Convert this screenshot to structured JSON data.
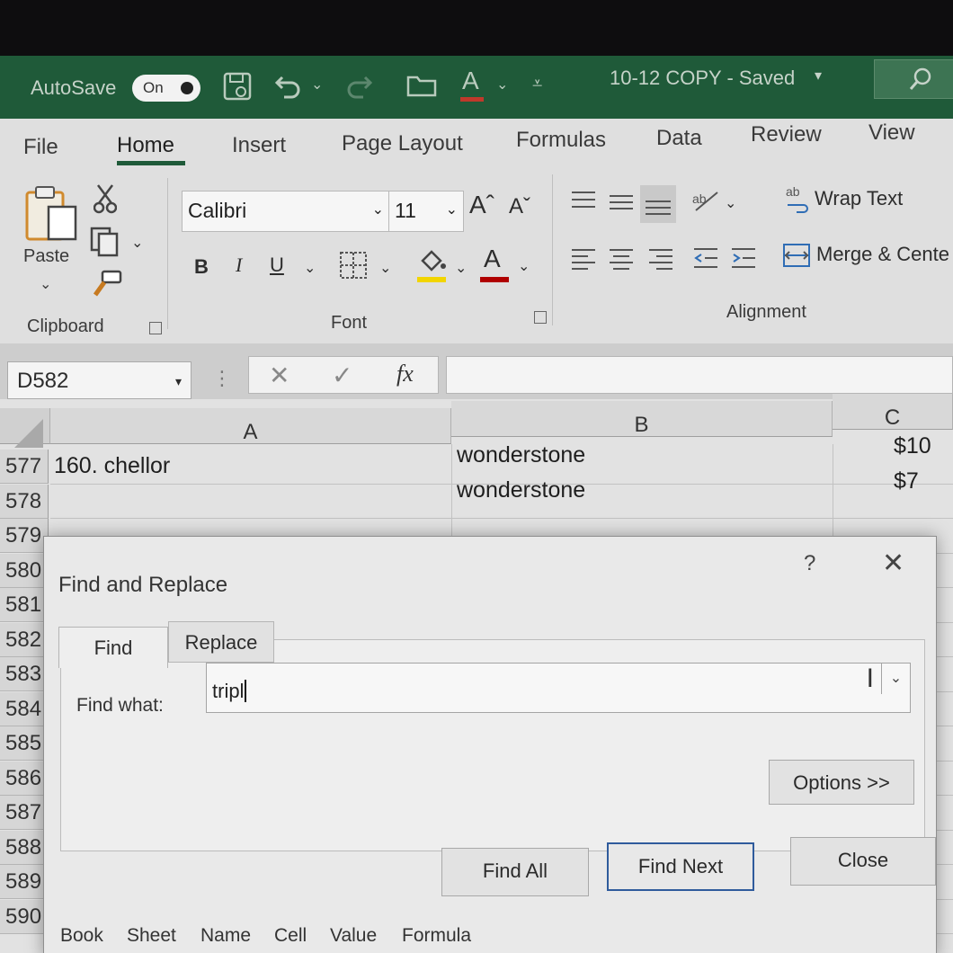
{
  "titlebar": {
    "autosave_label": "AutoSave",
    "autosave_state": "On",
    "doc_title": "10-12 COPY - Saved",
    "doc_title_arrow": "▾",
    "icons": [
      "save-icon",
      "undo-icon",
      "redo-icon",
      "open-folder-icon",
      "font-color-icon",
      "customize-icon",
      "search-icon"
    ]
  },
  "ribbon": {
    "tabs": [
      "File",
      "Home",
      "Insert",
      "Page Layout",
      "Formulas",
      "Data",
      "Review",
      "View"
    ],
    "active_tab": "Home",
    "clipboard": {
      "paste_label": "Paste",
      "group_label": "Clipboard"
    },
    "font": {
      "family": "Calibri",
      "size": "11",
      "bold": "B",
      "italic": "I",
      "underline": "U",
      "group_label": "Font",
      "fill_color": "#f2d500",
      "font_color": "#b00000"
    },
    "alignment": {
      "wrap_text": "Wrap Text",
      "merge_center": "Merge & Cente",
      "group_label": "Alignment"
    }
  },
  "formula_bar": {
    "name_box": "D582",
    "fx": "fx",
    "value": ""
  },
  "grid": {
    "columns": [
      "A",
      "B",
      "C"
    ],
    "rows": [
      {
        "num": "577",
        "a": "160. chellor",
        "b": "wonderstone",
        "c": "$10"
      },
      {
        "num": "578",
        "a": "",
        "b": "wonderstone",
        "c": "$7"
      },
      {
        "num": "579",
        "a": "",
        "b": "",
        "c": ""
      },
      {
        "num": "580",
        "a": "",
        "b": "",
        "c": ""
      },
      {
        "num": "581",
        "a": "",
        "b": "",
        "c": ""
      },
      {
        "num": "582",
        "a": "",
        "b": "",
        "c": ""
      },
      {
        "num": "583",
        "a": "",
        "b": "",
        "c": ""
      },
      {
        "num": "584",
        "a": "",
        "b": "",
        "c": ""
      },
      {
        "num": "585",
        "a": "",
        "b": "",
        "c": ""
      },
      {
        "num": "586",
        "a": "",
        "b": "",
        "c": ""
      },
      {
        "num": "587",
        "a": "",
        "b": "",
        "c": ""
      },
      {
        "num": "588",
        "a": "",
        "b": "",
        "c": ""
      },
      {
        "num": "589",
        "a": "",
        "b": "",
        "c": ""
      },
      {
        "num": "590",
        "a": "",
        "b": "",
        "c": ""
      }
    ]
  },
  "dialog": {
    "title": "Find and Replace",
    "help": "?",
    "tabs": [
      "Find",
      "Replace"
    ],
    "active_tab": "Find",
    "find_label": "Find what:",
    "find_value": "tripl",
    "options_label": "Options >>",
    "find_all": "Find All",
    "find_next": "Find Next",
    "close": "Close",
    "results_headers": [
      "Book",
      "Sheet",
      "Name",
      "Cell",
      "Value",
      "Formula"
    ]
  }
}
